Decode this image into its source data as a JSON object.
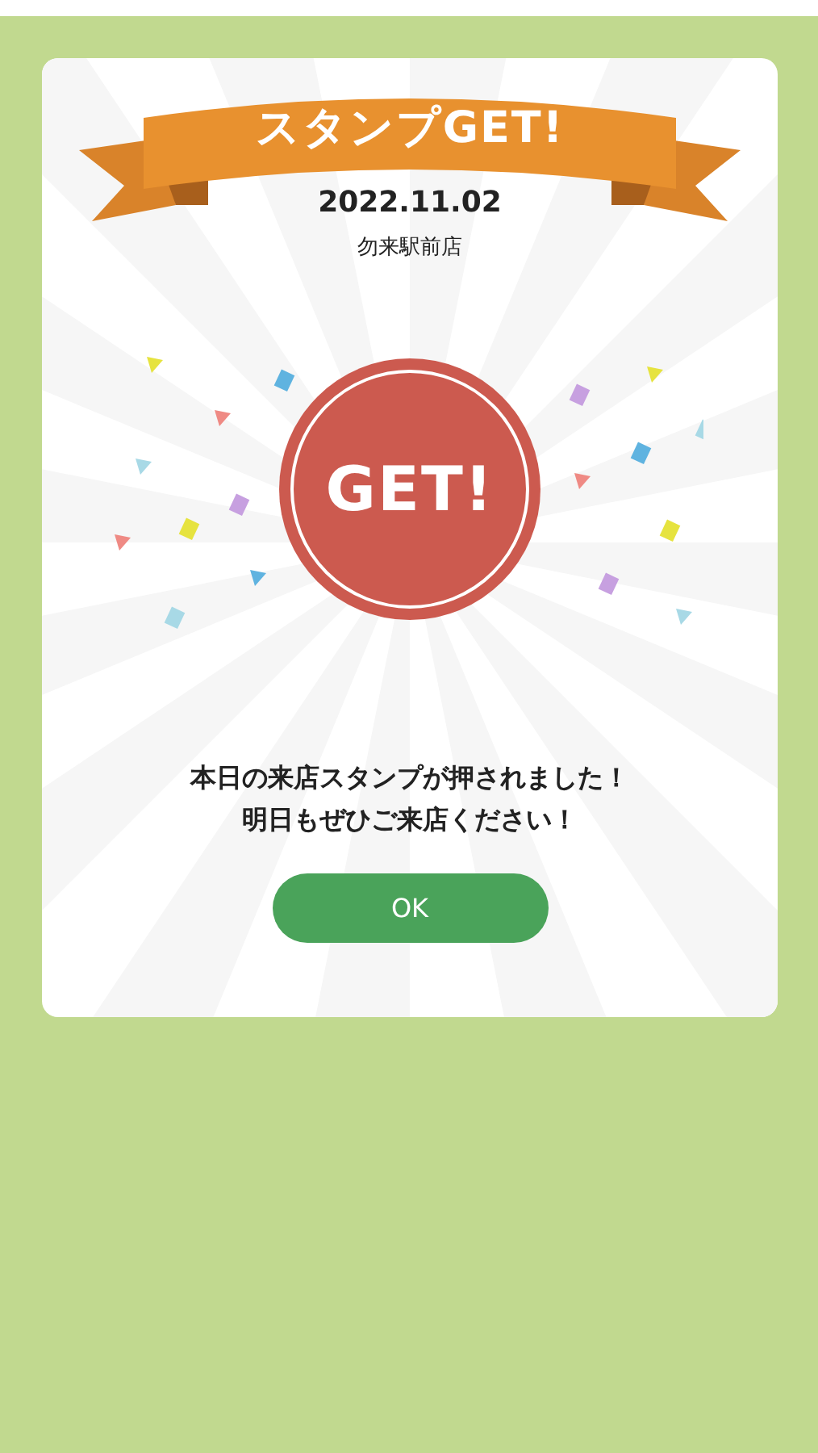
{
  "dialog": {
    "banner": "スタンプGET!",
    "date": "2022.11.02",
    "store": "勿来駅前店",
    "stamp": "GET!",
    "message": [
      "本日の来店スタンプが押されました！",
      "明日もぜひご来店ください！"
    ],
    "button": "OK"
  }
}
